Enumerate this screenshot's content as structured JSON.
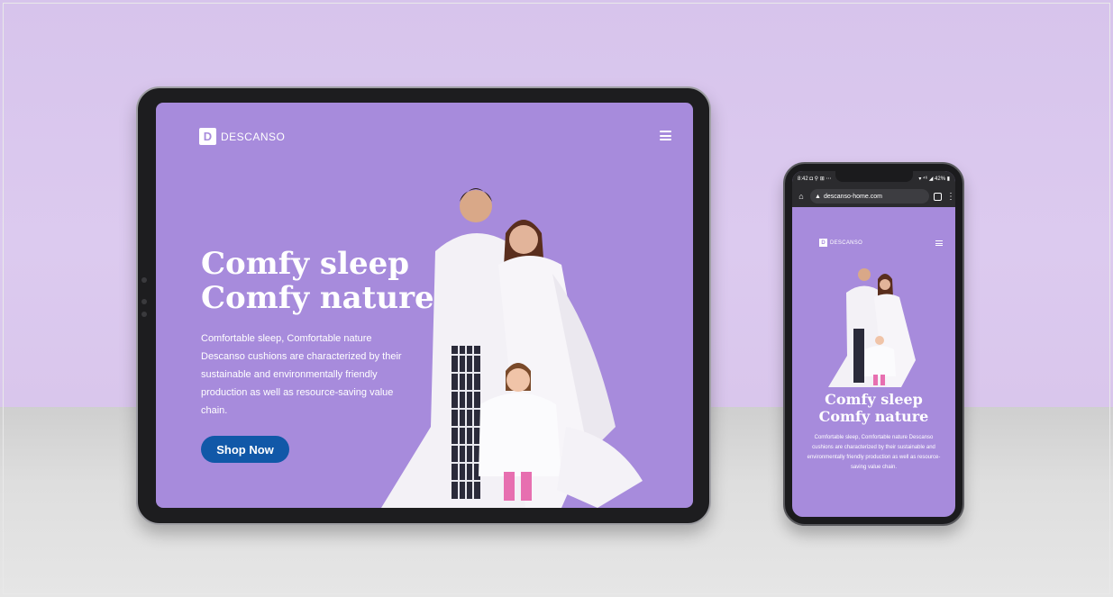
{
  "tablet": {
    "brand_mark": "D",
    "brand_name": "DESCANSO",
    "menu_icon": "hamburger-menu-icon",
    "hero_title_line1": "Comfy sleep",
    "hero_title_line2": "Comfy nature",
    "hero_description": "Comfortable sleep, Comfortable nature Descanso cushions are characterized by their sustainable and environmentally friendly production as well as resource-saving value chain.",
    "cta_label": "Shop Now"
  },
  "phone": {
    "status_left": "8:42 ◘ ⚲ ⊞ ⋯",
    "status_right": "▾ ⁴⁶ ◢ 42% ▮",
    "url": "descanso-home.com",
    "brand_mark": "D",
    "brand_name": "DESCANSO",
    "hero_title_line1": "Comfy sleep",
    "hero_title_line2": "Comfy nature",
    "hero_description": "Comfortable sleep, Comfortable nature Descanso cushions are characterized by their sustainable and environmentally friendly production as well as resource-saving value chain."
  },
  "colors": {
    "wall": "#d9c6ec",
    "screen_bg": "#a78bdc",
    "cta": "#1158a8",
    "device": "#1d1d1f"
  }
}
